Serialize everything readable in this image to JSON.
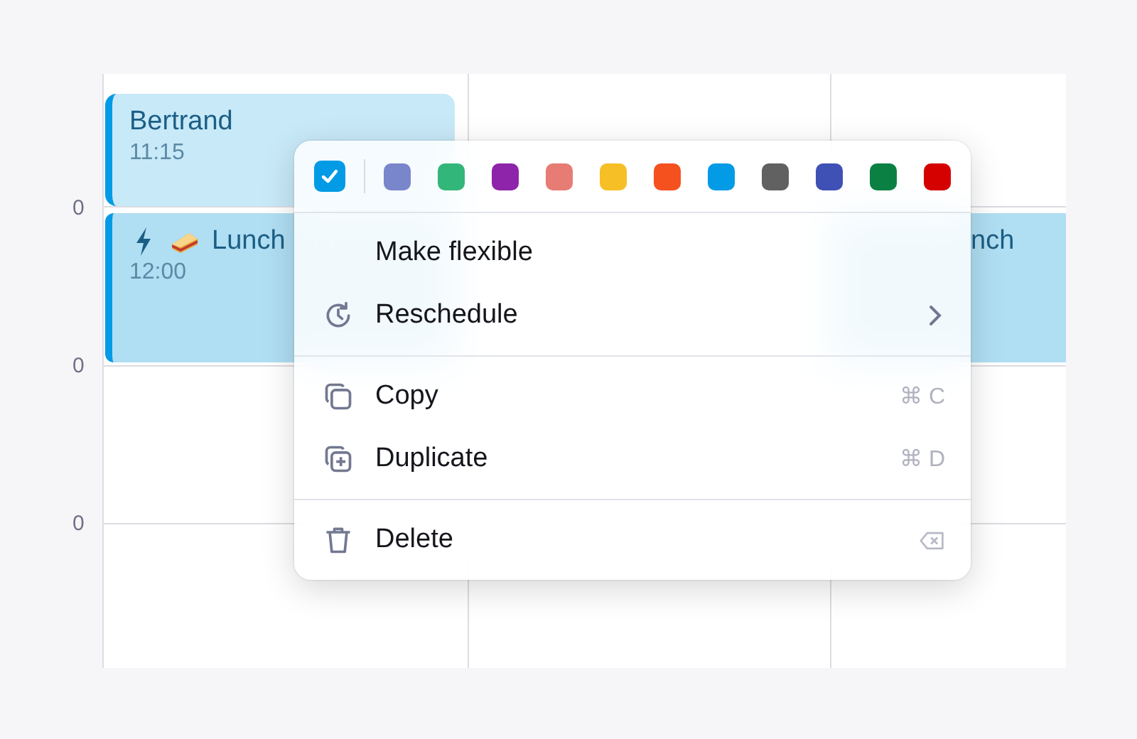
{
  "hour_labels": [
    "0",
    "0",
    "0"
  ],
  "events": [
    {
      "kind": "event",
      "title": "Bertrand",
      "time": "11:15"
    },
    {
      "kind": "lunch",
      "title": "Lunch",
      "time": "12:00"
    },
    {
      "kind": "partial",
      "title": "nch"
    }
  ],
  "context_menu": {
    "done_checkbox": {
      "checked": true
    },
    "swatches": [
      {
        "color": "#7986cb"
      },
      {
        "color": "#33b679"
      },
      {
        "color": "#8e24aa"
      },
      {
        "color": "#e67c73"
      },
      {
        "color": "#f6bf26"
      },
      {
        "color": "#f4511e"
      },
      {
        "color": "#039be5"
      },
      {
        "color": "#616161"
      },
      {
        "color": "#3f51b5"
      },
      {
        "color": "#0b8043"
      },
      {
        "color": "#d50000"
      }
    ],
    "sections": [
      [
        {
          "label": "Make flexible"
        },
        {
          "label": "Reschedule"
        }
      ],
      [
        {
          "label": "Copy",
          "shortcut": "⌘ C"
        },
        {
          "label": "Duplicate",
          "shortcut": "⌘ D"
        }
      ],
      [
        {
          "label": "Delete"
        }
      ]
    ]
  }
}
